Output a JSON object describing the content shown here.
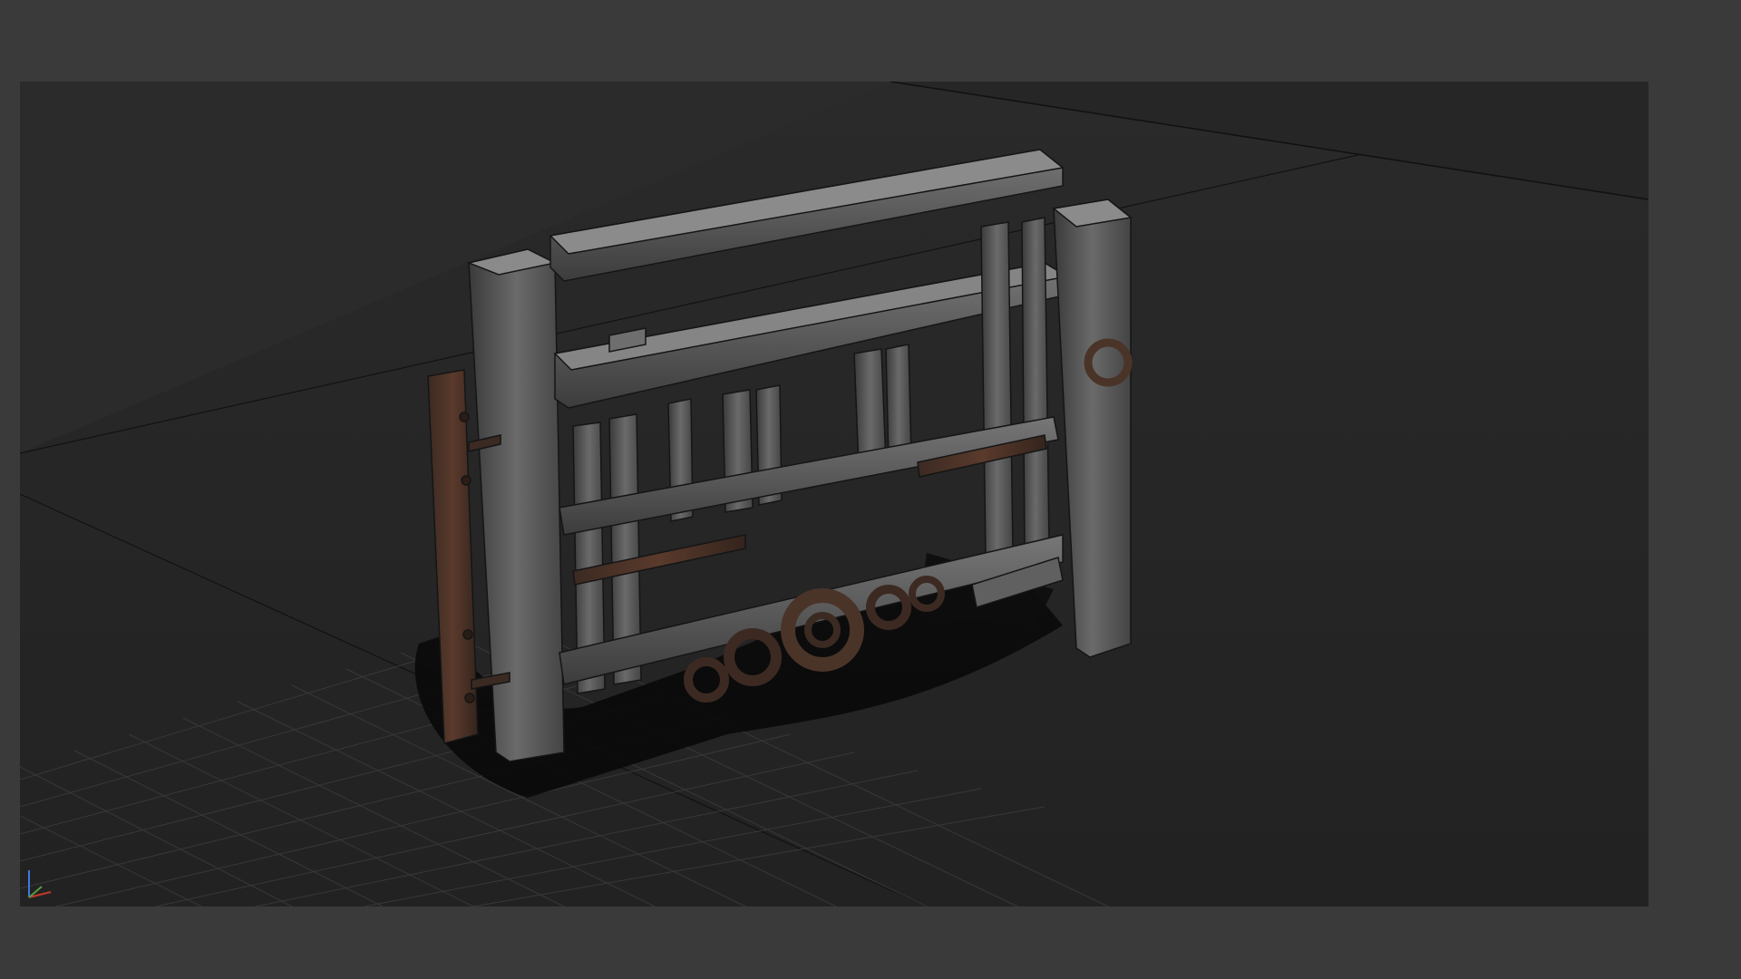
{
  "app": {
    "view": "perspective-viewport",
    "background_color": "#3a3a3a",
    "viewport_color": "#2b2b2b"
  },
  "viewport": {
    "model": "wooden-gate",
    "shading": "textured-with-wireframe",
    "grid": true,
    "axis_gizmo": {
      "x_color": "#c0392b",
      "y_color": "#3b7bd8"
    }
  }
}
